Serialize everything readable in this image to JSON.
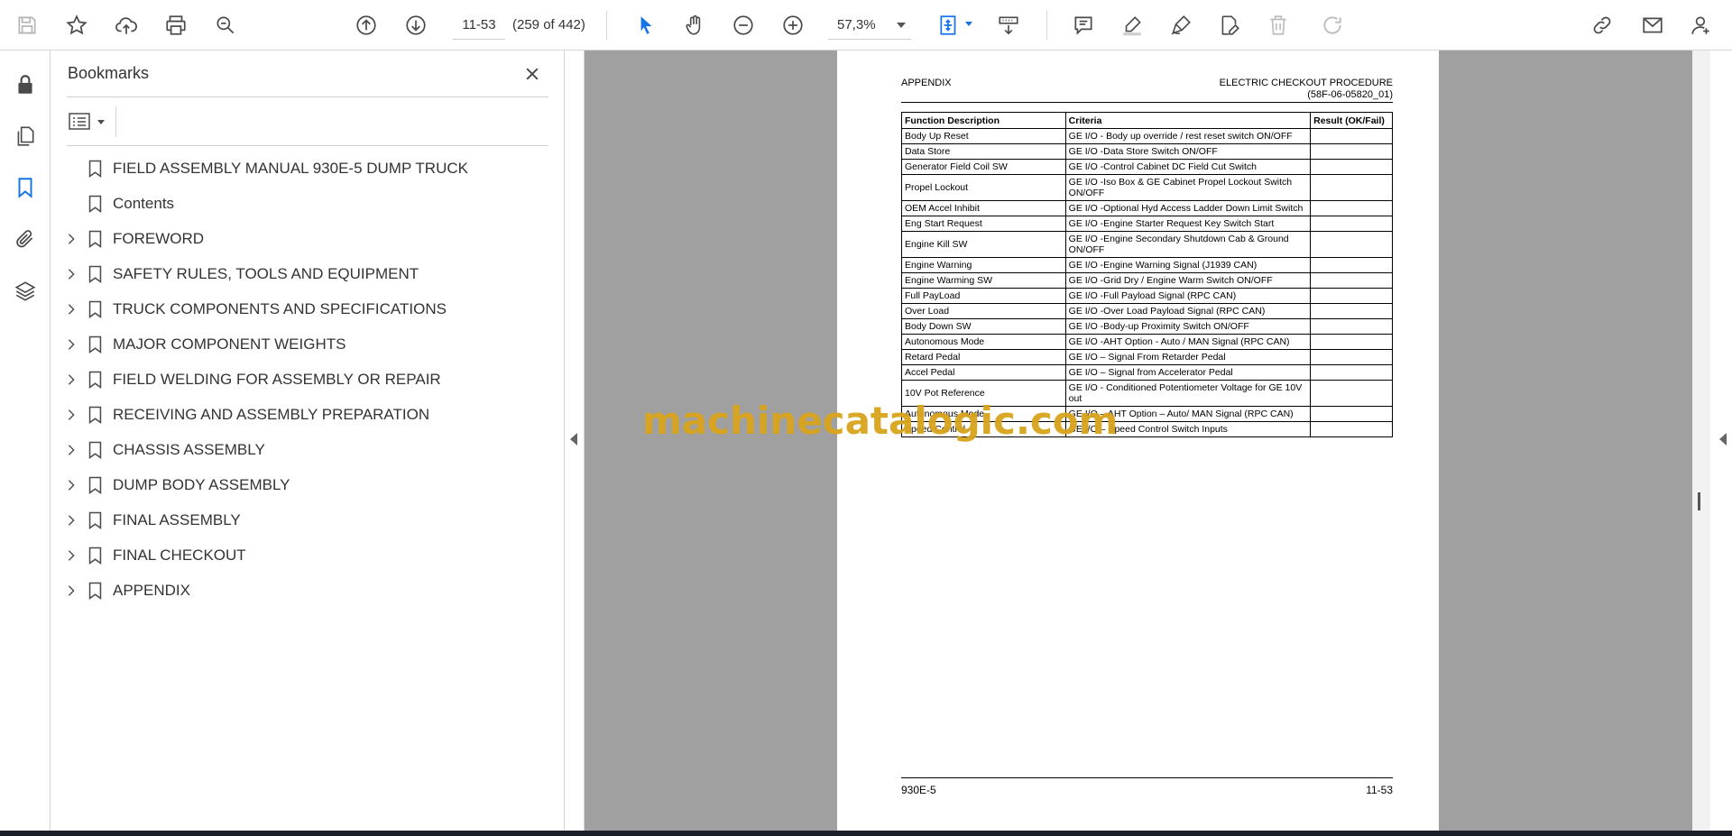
{
  "toolbar": {
    "page_input": "11-53",
    "page_count": "(259 of 442)",
    "zoom": "57,3%",
    "icons": [
      "save-icon",
      "star-icon",
      "cloud-upload-icon",
      "print-icon",
      "search-zoom-icon",
      "page-up-icon",
      "page-down-icon",
      "select-cursor-icon",
      "hand-icon",
      "zoom-out-icon",
      "zoom-in-icon",
      "fit-page-icon",
      "scroll-mode-icon",
      "comment-icon",
      "highlight-icon",
      "sign-icon",
      "edit-pdf-icon",
      "delete-icon",
      "redo-icon",
      "share-link-icon",
      "email-icon",
      "account-icon"
    ]
  },
  "rail": {
    "icons": [
      "lock-icon",
      "pages-icon",
      "bookmark-icon",
      "attachment-icon",
      "layers-icon"
    ]
  },
  "bookmarks": {
    "title": "Bookmarks",
    "items": [
      {
        "label": "FIELD ASSEMBLY MANUAL 930E-5  DUMP TRUCK",
        "expandable": false
      },
      {
        "label": "Contents",
        "expandable": false
      },
      {
        "label": "FOREWORD",
        "expandable": true
      },
      {
        "label": "SAFETY RULES, TOOLS AND EQUIPMENT",
        "expandable": true
      },
      {
        "label": "TRUCK COMPONENTS AND SPECIFICATIONS",
        "expandable": true
      },
      {
        "label": "MAJOR COMPONENT WEIGHTS",
        "expandable": true
      },
      {
        "label": "FIELD WELDING FOR ASSEMBLY OR REPAIR",
        "expandable": true
      },
      {
        "label": "RECEIVING AND ASSEMBLY PREPARATION",
        "expandable": true
      },
      {
        "label": "CHASSIS ASSEMBLY",
        "expandable": true
      },
      {
        "label": "DUMP BODY ASSEMBLY",
        "expandable": true
      },
      {
        "label": "FINAL ASSEMBLY",
        "expandable": true
      },
      {
        "label": "FINAL CHECKOUT",
        "expandable": true
      },
      {
        "label": "APPENDIX",
        "expandable": true
      }
    ]
  },
  "document": {
    "header_left": "APPENDIX",
    "header_right_1": "ELECTRIC CHECKOUT PROCEDURE",
    "header_right_2": "(58F-06-05820_01)",
    "table": {
      "headers": [
        "Function Description",
        "Criteria",
        "Result (OK/Fail)"
      ],
      "rows": [
        [
          "Body Up Reset",
          "GE I/O - Body up override / rest reset switch ON/OFF",
          ""
        ],
        [
          "Data Store",
          "GE I/O -Data Store Switch ON/OFF",
          ""
        ],
        [
          "Generator Field Coil SW",
          "GE I/O -Control Cabinet DC Field Cut Switch",
          ""
        ],
        [
          "Propel Lockout",
          "GE I/O -Iso Box & GE Cabinet Propel Lockout Switch ON/OFF",
          ""
        ],
        [
          "OEM Accel Inhibit",
          "GE I/O -Optional Hyd Access Ladder Down Limit Switch",
          ""
        ],
        [
          "Eng Start Request",
          "GE I/O -Engine Starter Request Key Switch Start",
          ""
        ],
        [
          "Engine Kill SW",
          "GE I/O -Engine Secondary Shutdown Cab & Ground ON/OFF",
          ""
        ],
        [
          "Engine Warning",
          "GE I/O -Engine Warning Signal (J1939 CAN)",
          ""
        ],
        [
          "Engine Warming SW",
          "GE I/O -Grid Dry / Engine Warm Switch ON/OFF",
          ""
        ],
        [
          "Full PayLoad",
          "GE I/O -Full Payload Signal (RPC CAN)",
          ""
        ],
        [
          "Over Load",
          "GE I/O -Over Load Payload Signal (RPC CAN)",
          ""
        ],
        [
          "Body Down SW",
          "GE I/O -Body-up Proximity Switch ON/OFF",
          ""
        ],
        [
          "Autonomous Mode",
          "GE I/O -AHT Option - Auto / MAN Signal (RPC CAN)",
          ""
        ],
        [
          "Retard Pedal",
          "GE I/O – Signal From Retarder Pedal",
          ""
        ],
        [
          "Accel Pedal",
          "GE I/O – Signal from Accelerator Pedal",
          ""
        ],
        [
          "10V Pot Reference",
          "GE I/O - Conditioned Potentiometer Voltage for GE 10V out",
          ""
        ],
        [
          "Autonomous Mode",
          "GE I/O – AHT Option – Auto/ MAN Signal (RPC CAN)",
          ""
        ],
        [
          "Speed Control",
          "GE I/O – Speed Control Switch Inputs",
          ""
        ]
      ]
    },
    "footer_left": "930E-5",
    "footer_right": "11-53"
  },
  "watermark": "machinecatalogic.com",
  "colors": {
    "accent_blue": "#1473e6",
    "icon_grey": "#4b4b4b",
    "viewport_bg": "#a0a0a0",
    "watermark": "#d9a41c"
  }
}
